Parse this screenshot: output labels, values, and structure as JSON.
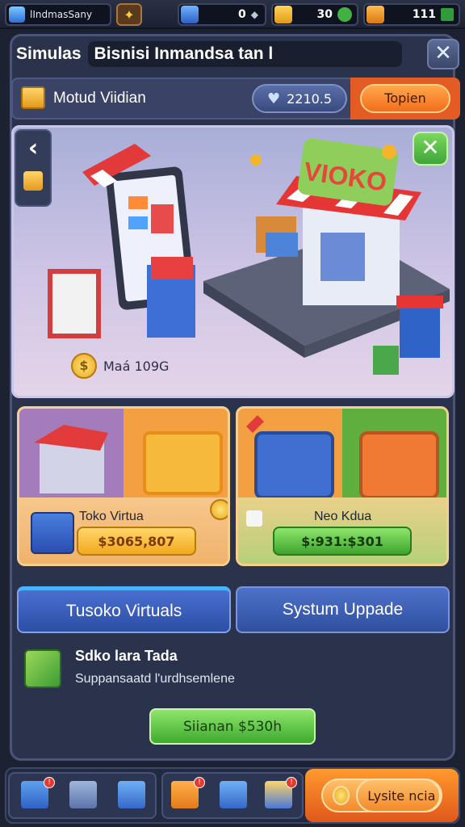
{
  "topbar": {
    "brand_label": "lIndmasSany",
    "stat1": "0",
    "stat2": "30",
    "stat3": "111"
  },
  "window": {
    "title_a": "Simulas",
    "title_b": "Bisnisi Inmandsa tan l",
    "close_icon": "close-icon"
  },
  "subbar": {
    "title": "Motud Viidian",
    "balance": "2210.5",
    "topup": "Topien"
  },
  "scene": {
    "store_sign": "VIOKO",
    "coin_readout": "Maá 109G"
  },
  "cards": [
    {
      "name": "Toko Virtua",
      "price": "$3065,807"
    },
    {
      "name": "Neo Kdua",
      "price": "$:931:$301"
    }
  ],
  "tabs": {
    "left": "Tusoko Virtuals",
    "right": "Systum Uppade"
  },
  "bonus": {
    "title": "Sdko lara Tada",
    "subtitle": "Suppansaatd l'urdhsemlene",
    "claim": "Siianan $530h"
  },
  "dock": {
    "cta": "Lysite ncia"
  },
  "colors": {
    "panel": "#2b324b",
    "accent_orange": "#f26d1c",
    "accent_green": "#3eaa2e",
    "accent_blue": "#2c4ea6"
  }
}
